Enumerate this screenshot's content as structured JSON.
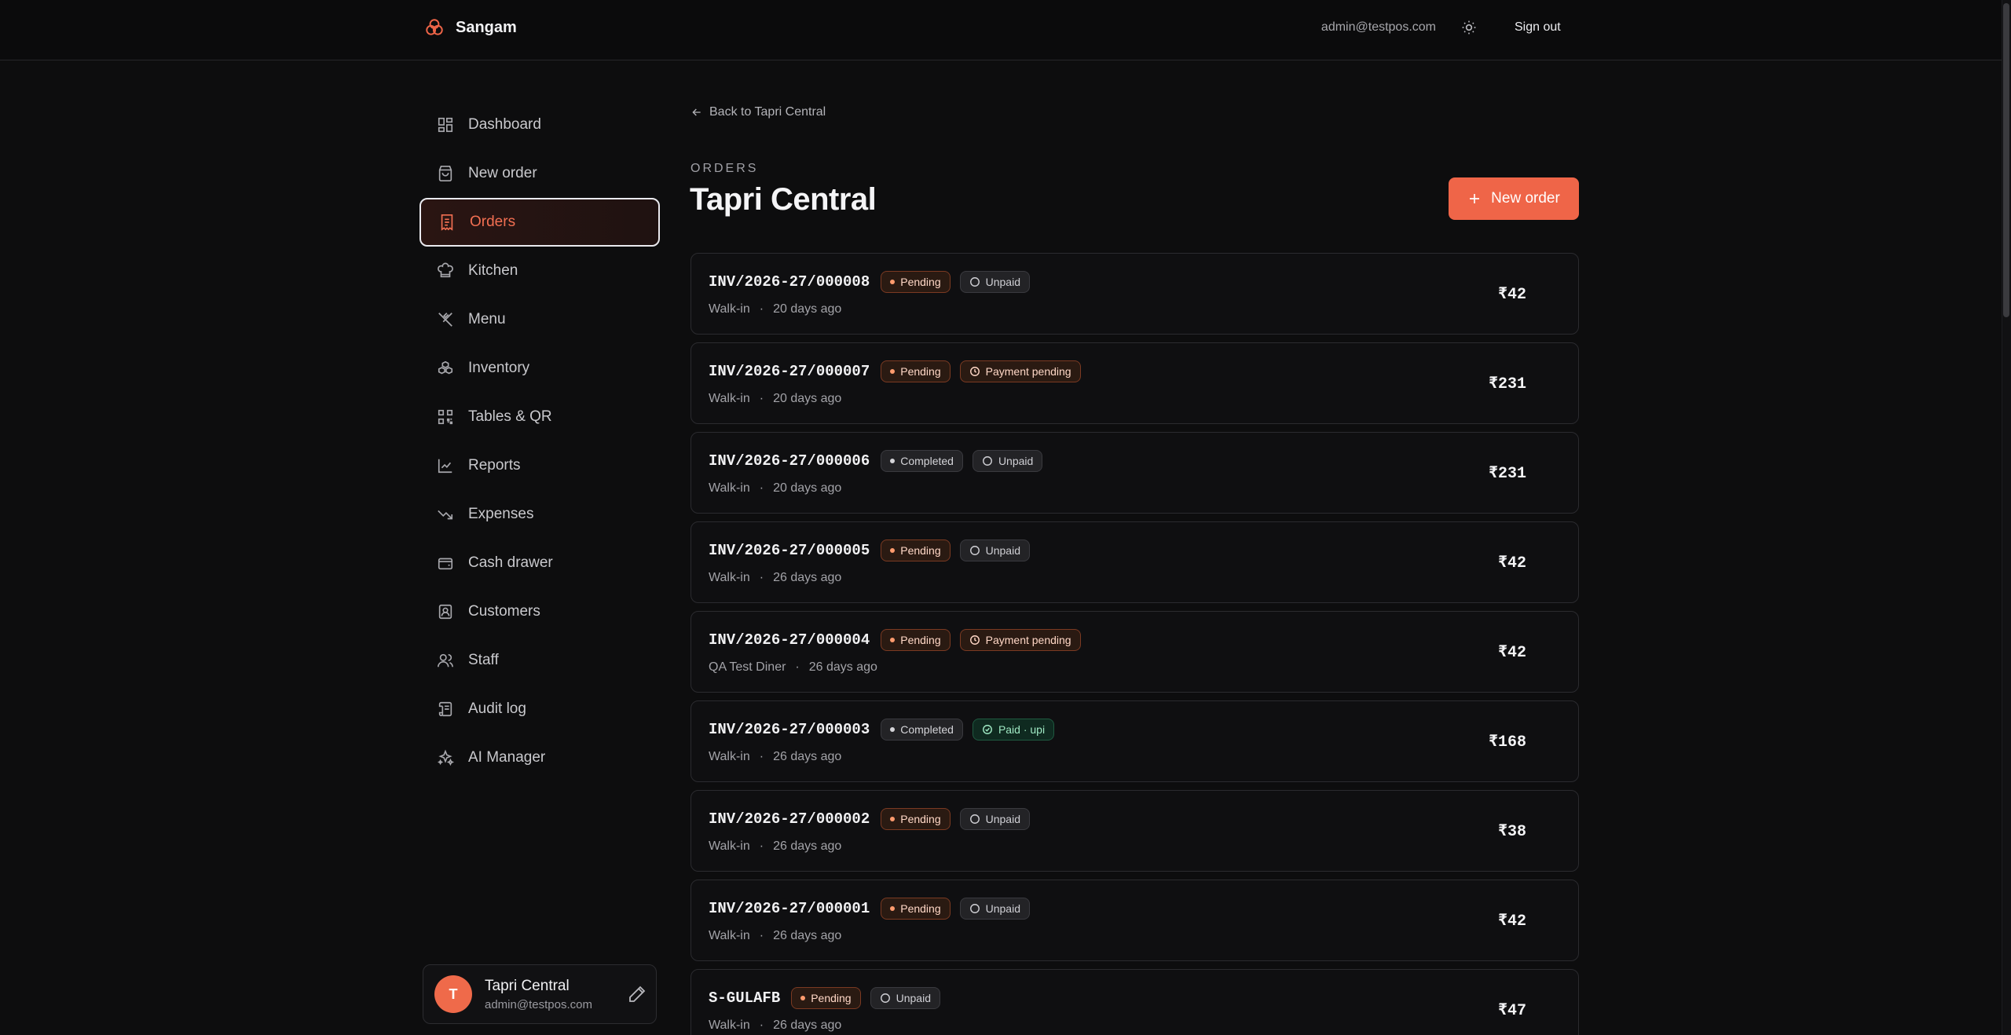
{
  "app": {
    "brand": "Sangam",
    "user_email": "admin@testpos.com",
    "sign_out": "Sign out"
  },
  "nav": {
    "items": [
      {
        "label": "Dashboard",
        "icon": "dashboard-icon"
      },
      {
        "label": "New order",
        "icon": "shopping-bag-icon"
      },
      {
        "label": "Orders",
        "icon": "receipt-icon",
        "active": true
      },
      {
        "label": "Kitchen",
        "icon": "chef-hat-icon"
      },
      {
        "label": "Menu",
        "icon": "utensils-icon"
      },
      {
        "label": "Inventory",
        "icon": "boxes-icon"
      },
      {
        "label": "Tables & QR",
        "icon": "qr-code-icon"
      },
      {
        "label": "Reports",
        "icon": "line-chart-icon"
      },
      {
        "label": "Expenses",
        "icon": "trending-down-icon"
      },
      {
        "label": "Cash drawer",
        "icon": "wallet-icon"
      },
      {
        "label": "Customers",
        "icon": "contact-icon"
      },
      {
        "label": "Staff",
        "icon": "users-icon"
      },
      {
        "label": "Audit log",
        "icon": "scroll-icon"
      },
      {
        "label": "AI Manager",
        "icon": "sparkles-icon"
      }
    ]
  },
  "profile": {
    "initial": "T",
    "name": "Tapri Central",
    "email": "admin@testpos.com"
  },
  "main": {
    "back_link": "Back to Tapri Central",
    "eyebrow": "ORDERS",
    "title": "Tapri Central",
    "new_order_button": "New order"
  },
  "orders": [
    {
      "id": "INV/2026-27/000008",
      "status": "Pending",
      "payment": "Unpaid",
      "customer": "Walk-in",
      "sep": "·",
      "time": "20 days ago",
      "amount": "₹42"
    },
    {
      "id": "INV/2026-27/000007",
      "status": "Pending",
      "payment": "Payment pending",
      "customer": "Walk-in",
      "sep": "·",
      "time": "20 days ago",
      "amount": "₹231"
    },
    {
      "id": "INV/2026-27/000006",
      "status": "Completed",
      "payment": "Unpaid",
      "customer": "Walk-in",
      "sep": "·",
      "time": "20 days ago",
      "amount": "₹231"
    },
    {
      "id": "INV/2026-27/000005",
      "status": "Pending",
      "payment": "Unpaid",
      "customer": "Walk-in",
      "sep": "·",
      "time": "26 days ago",
      "amount": "₹42"
    },
    {
      "id": "INV/2026-27/000004",
      "status": "Pending",
      "payment": "Payment pending",
      "customer": "QA Test Diner",
      "sep": "·",
      "time": "26 days ago",
      "amount": "₹42"
    },
    {
      "id": "INV/2026-27/000003",
      "status": "Completed",
      "payment": "Paid · upi",
      "customer": "Walk-in",
      "sep": "·",
      "time": "26 days ago",
      "amount": "₹168"
    },
    {
      "id": "INV/2026-27/000002",
      "status": "Pending",
      "payment": "Unpaid",
      "customer": "Walk-in",
      "sep": "·",
      "time": "26 days ago",
      "amount": "₹38"
    },
    {
      "id": "INV/2026-27/000001",
      "status": "Pending",
      "payment": "Unpaid",
      "customer": "Walk-in",
      "sep": "·",
      "time": "26 days ago",
      "amount": "₹42"
    },
    {
      "id": "S-GULAFB",
      "status": "Pending",
      "payment": "Unpaid",
      "customer": "Walk-in",
      "sep": "·",
      "time": "26 days ago",
      "amount": "₹47"
    }
  ],
  "colors": {
    "accent": "#ef6548",
    "background": "#0d0d0e",
    "card_border": "#2b2b2f"
  }
}
